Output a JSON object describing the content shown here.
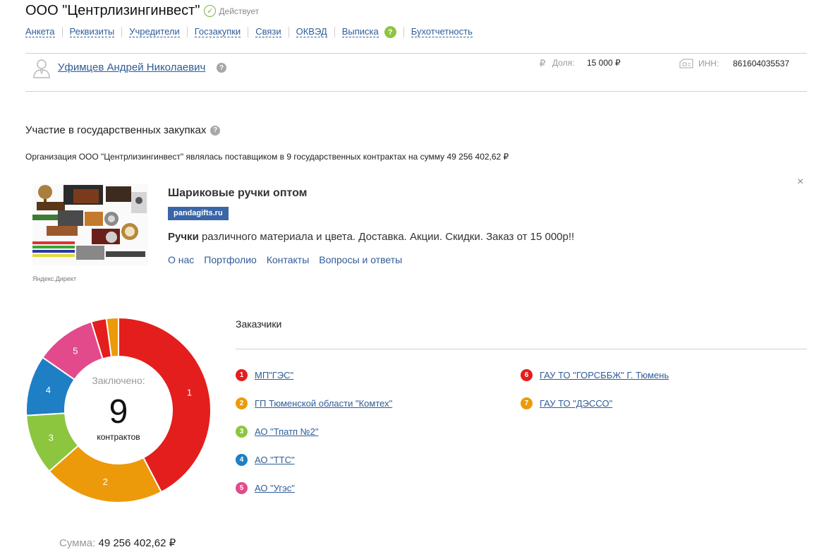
{
  "company": {
    "title": "ООО \"Центрлизингинвест\"",
    "status": "Действует"
  },
  "tabs": [
    "Анкета",
    "Реквизиты",
    "Учредители",
    "Госзакупки",
    "Связи",
    "ОКВЭД",
    "Выписка",
    "Бухотчетность"
  ],
  "help_mark": "?",
  "founder": {
    "name": "Уфимцев Андрей Николаевич",
    "share_icon": "₽",
    "share_label": "Доля:",
    "share_value": "15 000 ₽",
    "inn_label": "ИНН:",
    "inn_value": "861604035537"
  },
  "procurement": {
    "title": "Участие в государственных закупках",
    "summary": "Организация ООО \"Центрлизингинвест\" являлась поставщиком в 9 государственных контрактах на сумму 49 256 402,62 ₽"
  },
  "ad": {
    "title": "Шариковые ручки оптом",
    "domain": "pandagifts.ru",
    "text_bold": "Ручки",
    "text_rest": " различного материала и цвета. Доставка. Акции. Скидки. Заказ от 15 000р!!",
    "links": [
      "О нас",
      "Портфолио",
      "Контакты",
      "Вопросы и ответы"
    ],
    "label": "Яндекс.Директ",
    "close": "×"
  },
  "contracts": {
    "center_label": "Заключено:",
    "count": "9",
    "unit": "контрактов",
    "sum_label": "Сумма:",
    "sum_value": "49 256 402,62 ₽"
  },
  "customers": {
    "title": "Заказчики",
    "items": [
      {
        "num": "1",
        "name": "МП\"ГЭС\"",
        "color": "#e41e1c"
      },
      {
        "num": "2",
        "name": "ГП Тюменской области \"Комтех\"",
        "color": "#ec9a09"
      },
      {
        "num": "3",
        "name": "АО \"Тпатп №2\"",
        "color": "#8cc63f"
      },
      {
        "num": "4",
        "name": "АО \"ТТС\"",
        "color": "#1f7fc4"
      },
      {
        "num": "5",
        "name": "АО \"Угэс\"",
        "color": "#e24a8b"
      },
      {
        "num": "6",
        "name": "ГАУ ТО \"ГОРСББЖ\" Г. Тюмень",
        "color": "#e41e1c"
      },
      {
        "num": "7",
        "name": "ГАУ ТО \"ДЭССО\"",
        "color": "#ec9a09"
      }
    ]
  },
  "chart_data": {
    "type": "pie",
    "categories": [
      "1",
      "2",
      "3",
      "4",
      "5",
      "6",
      "7"
    ],
    "values": [
      4,
      2,
      1,
      1,
      1,
      0.25,
      0.2
    ],
    "colors": [
      "#e41e1c",
      "#ec9a09",
      "#8cc63f",
      "#1f7fc4",
      "#e24a8b",
      "#e41e1c",
      "#ec9a09"
    ],
    "labels": [
      "1",
      "2",
      "3",
      "4",
      "5",
      "",
      ""
    ]
  }
}
